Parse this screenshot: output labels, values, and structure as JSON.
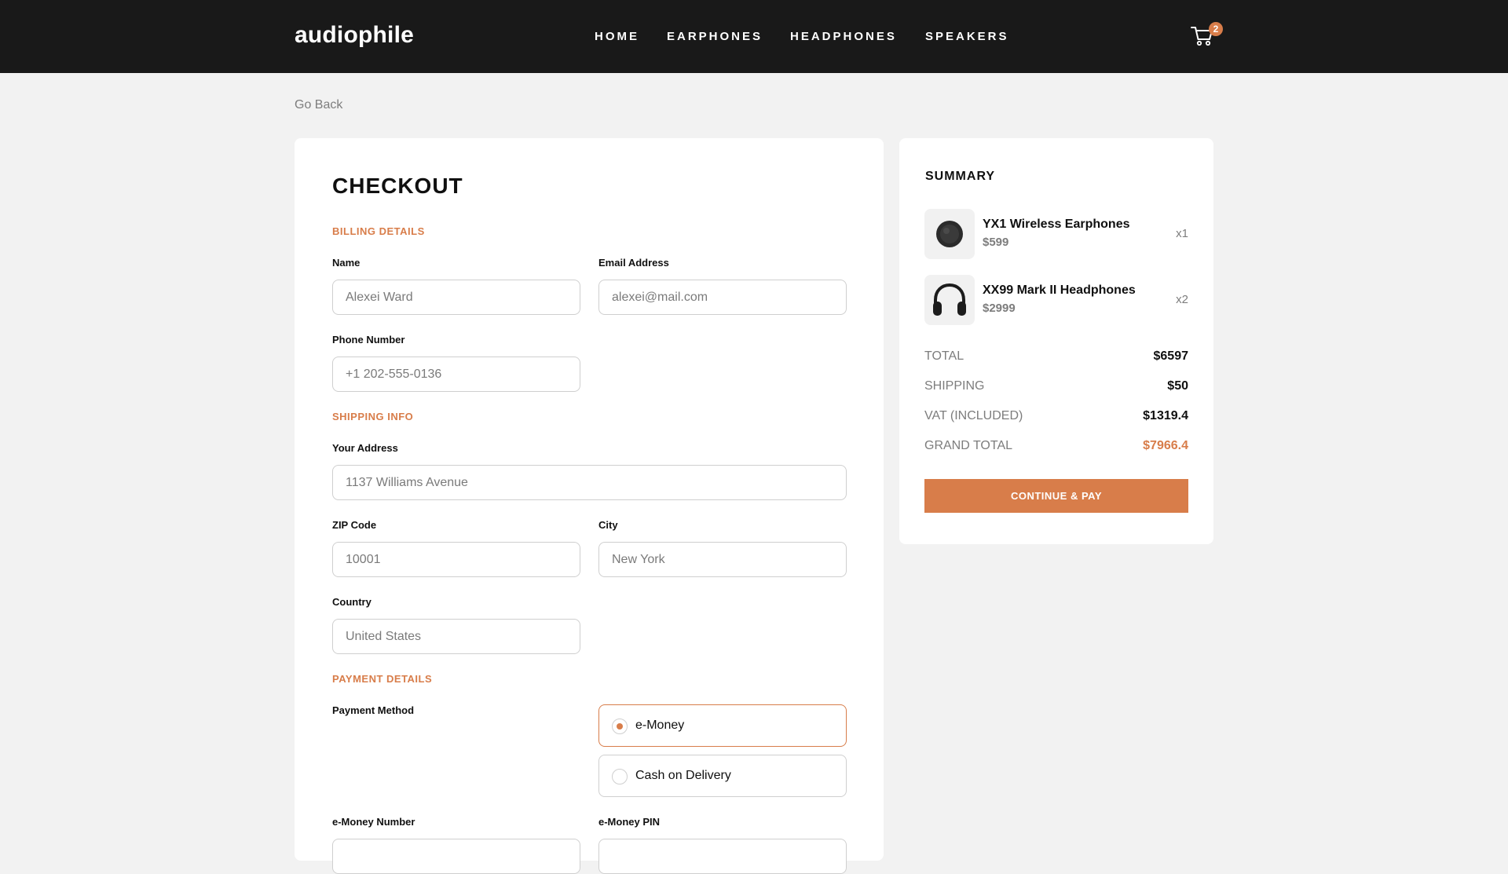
{
  "header": {
    "logo": "audiophile",
    "nav": [
      {
        "label": "HOME"
      },
      {
        "label": "EARPHONES"
      },
      {
        "label": "HEADPHONES"
      },
      {
        "label": "SPEAKERS"
      }
    ],
    "cart_count": "2",
    "cart_icon": "cart-icon"
  },
  "go_back": "Go Back",
  "checkout": {
    "title": "CHECKOUT",
    "billing": {
      "title": "BILLING DETAILS",
      "name_label": "Name",
      "name_placeholder": "Alexei Ward",
      "email_label": "Email Address",
      "email_placeholder": "alexei@mail.com",
      "phone_label": "Phone Number",
      "phone_placeholder": "+1 202-555-0136"
    },
    "shipping": {
      "title": "SHIPPING INFO",
      "address_label": "Your Address",
      "address_placeholder": "1137 Williams Avenue",
      "zip_label": "ZIP Code",
      "zip_placeholder": "10001",
      "city_label": "City",
      "city_placeholder": "New York",
      "country_label": "Country",
      "country_placeholder": "United States"
    },
    "payment": {
      "title": "PAYMENT DETAILS",
      "method_label": "Payment Method",
      "options": [
        {
          "label": "e-Money",
          "selected": true
        },
        {
          "label": "Cash on Delivery",
          "selected": false
        }
      ],
      "emoney_number_label": "e-Money Number",
      "emoney_pin_label": "e-Money PIN"
    }
  },
  "summary": {
    "title": "SUMMARY",
    "items": [
      {
        "name": "YX1 Wireless Earphones",
        "price": "$599",
        "qty": "x1",
        "icon": "earphones-icon"
      },
      {
        "name": "XX99 Mark II Headphones",
        "price": "$2999",
        "qty": "x2",
        "icon": "headphones-icon"
      }
    ],
    "totals": [
      {
        "label": "TOTAL",
        "value": "$6597"
      },
      {
        "label": "SHIPPING",
        "value": "$50"
      },
      {
        "label": "VAT (INCLUDED)",
        "value": "$1319.4"
      },
      {
        "label": "GRAND TOTAL",
        "value": "$7966.4"
      }
    ],
    "button": "CONTINUE & PAY"
  },
  "colors": {
    "accent": "#d87d4a",
    "header_bg": "#191919",
    "page_bg": "#f2f2f2"
  }
}
